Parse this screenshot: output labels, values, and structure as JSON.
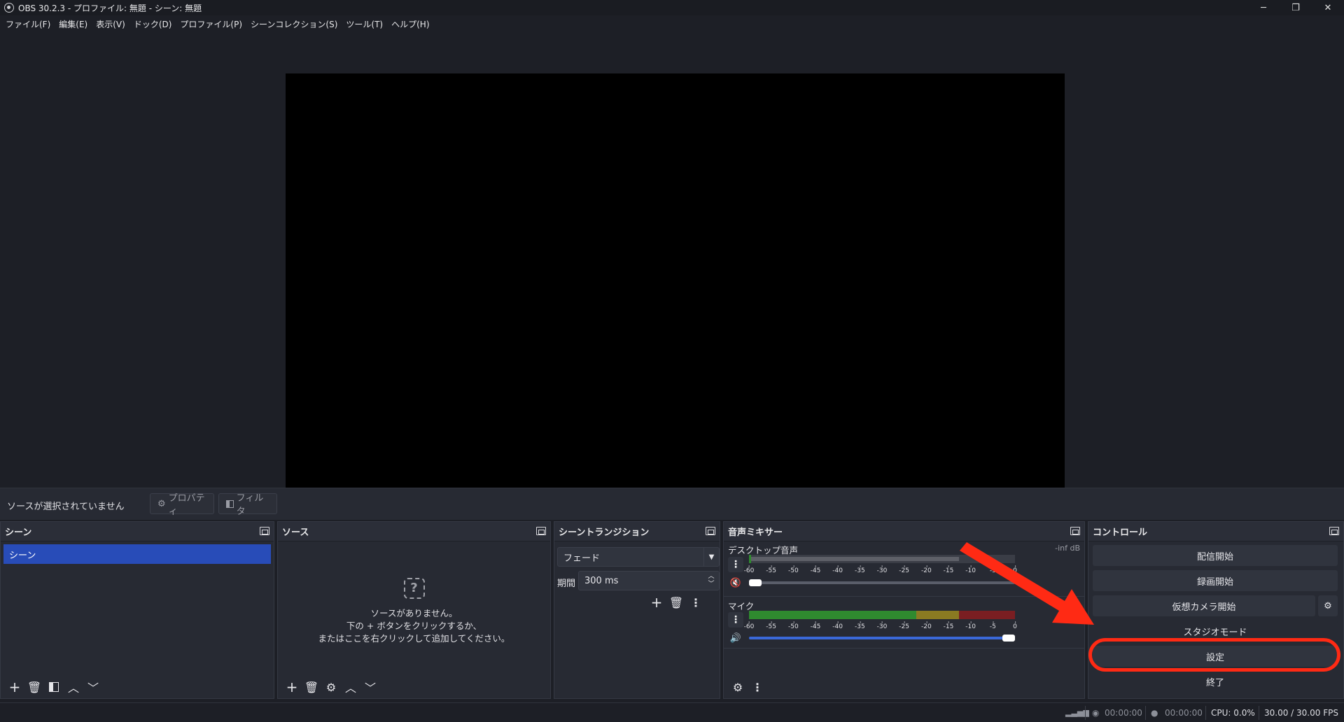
{
  "window": {
    "title": "OBS 30.2.3 - プロファイル: 無題 - シーン: 無題",
    "minimize": "─",
    "maximize": "❐",
    "close": "✕"
  },
  "menu": [
    "ファイル(F)",
    "編集(E)",
    "表示(V)",
    "ドック(D)",
    "プロファイル(P)",
    "シーンコレクション(S)",
    "ツール(T)",
    "ヘルプ(H)"
  ],
  "source_toolbar": {
    "no_source": "ソースが選択されていません",
    "properties": "プロパティ",
    "filters": "フィルタ"
  },
  "scenes": {
    "title": "シーン",
    "items": [
      "シーン"
    ]
  },
  "sources": {
    "title": "ソース",
    "empty_line1": "ソースがありません。",
    "empty_line2": "下の + ボタンをクリックするか、",
    "empty_line3": "またはここを右クリックして追加してください。"
  },
  "transitions": {
    "title": "シーントランジション",
    "selected": "フェード",
    "duration_label": "期間",
    "duration_value": "300 ms"
  },
  "mixer": {
    "title": "音声ミキサー",
    "scale": [
      "-60",
      "-55",
      "-50",
      "-45",
      "-40",
      "-35",
      "-30",
      "-25",
      "-20",
      "-15",
      "-10",
      "-5",
      "0"
    ],
    "channels": [
      {
        "name": "デスクトップ音声",
        "db": "-inf dB",
        "muted": true,
        "volume": 0.0
      },
      {
        "name": "マイク",
        "db": "",
        "muted": false,
        "volume": 1.0
      }
    ]
  },
  "controls": {
    "title": "コントロール",
    "start_streaming": "配信開始",
    "start_recording": "録画開始",
    "start_virtualcam": "仮想カメラ開始",
    "studio_mode": "スタジオモード",
    "settings": "設定",
    "exit": "終了"
  },
  "status": {
    "stream_time": "00:00:00",
    "record_time": "00:00:00",
    "cpu": "CPU: 0.0%",
    "fps": "30.00 / 30.00 FPS"
  },
  "colors": {
    "accent": "#284cb8",
    "annotation": "#ff2a14",
    "meter_green": "#2f8a2f",
    "meter_yellow": "#8a7a22",
    "meter_red": "#7a1e22"
  }
}
